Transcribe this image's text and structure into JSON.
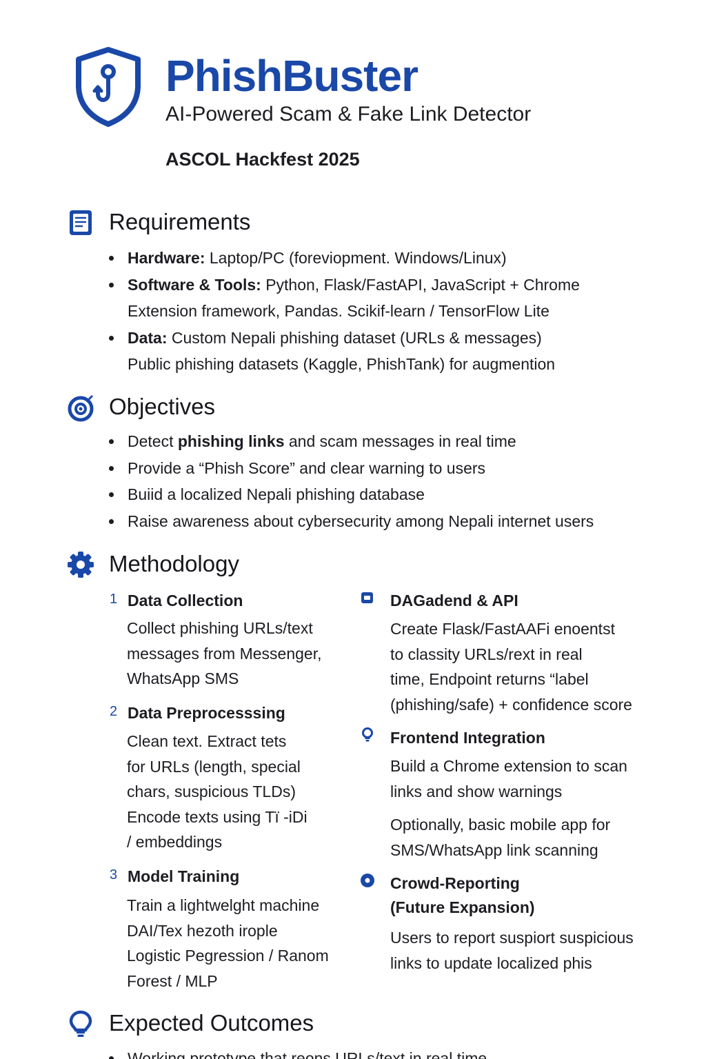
{
  "header": {
    "title": "PhishBuster",
    "subtitle": "AI-Powered Scam & Fake Link Detector",
    "event": "ASCOL Hackfest 2025",
    "logo_icon": "shield-hook-icon",
    "accent_color": "#1a48a8"
  },
  "requirements": {
    "title": "Requirements",
    "icon": "document-icon",
    "items": [
      {
        "label": "Hardware:",
        "text": " Laptop/PC (foreviopment. Windows/Linux)"
      },
      {
        "label": "Software & Tools:",
        "text": " Python, Flask/FastAPI, JavaScript + Chrome Extension framework, Pandas. Scikif-learn / TensorFlow Lite"
      },
      {
        "label": "Data:",
        "text": " Custom Nepali phishing dataset (URLs & messages) Public phishing datasets (Kaggle, PhishTank) for augmention"
      }
    ]
  },
  "objectives": {
    "title": "Objectives",
    "icon": "target-icon",
    "items": [
      {
        "before": "Detect ",
        "bold": "phishing links",
        "after": " and scam messages in real time"
      },
      {
        "before": "Provide a “Phish Score” and clear warning to users",
        "bold": "",
        "after": ""
      },
      {
        "before": "Buiid a localized Nepali phishing database",
        "bold": "",
        "after": ""
      },
      {
        "before": "Raise awareness about cybersecurity among Nepali internet users",
        "bold": "",
        "after": ""
      }
    ]
  },
  "methodology": {
    "title": "Methodology",
    "icon": "gear-icon",
    "left": [
      {
        "num": "1",
        "title": "Data Collection",
        "lines": [
          "Collect phishing URLs/text",
          "messages from Messenger,",
          "WhatsApp  SMS"
        ]
      },
      {
        "num": "2",
        "title": "Data Preprocesssing",
        "lines": [
          "Clean text. Extract tets",
          "for URLs (length, special",
          "chars, suspicious TLDs)",
          "Encode texts using Tï -iDi",
          "/ embeddings"
        ]
      },
      {
        "num": "3",
        "title": "Model Training",
        "lines": [
          "Train a lightwelght machine",
          "DAI/Tex hezoth irople",
          "Logistic Pegression / Ranom",
          "Forest / MLP"
        ]
      }
    ],
    "right": [
      {
        "icon": "server-icon",
        "title": "DAGadend & API",
        "lines": [
          "Create Flask/FastAAFi enoentst",
          "to classity URLs/rext in real",
          "time, Endpoint returns “label",
          "(phishing/safe) + confidence score"
        ],
        "extra": []
      },
      {
        "icon": "lightbulb-icon",
        "title": "Frontend Integration",
        "lines": [
          "Build a Chrome extension to scan",
          "links and show warnings"
        ],
        "extra": [
          "Optionally, basic mobile app for",
          "SMS/WhatsApp link scanning"
        ]
      },
      {
        "icon": "record-icon",
        "title": "Crowd-Reporting",
        "title2": "(Future Expansion)",
        "lines": [
          "Users to report suspiort suspicious",
          "links to update localized phis"
        ],
        "extra": []
      }
    ]
  },
  "outcomes": {
    "title": "Expected Outcomes",
    "icon": "lightbulb-icon",
    "items": [
      {
        "before": "Working prototype that reons URLs/text in real time",
        "bold": "",
        "after": ""
      }
    ]
  }
}
